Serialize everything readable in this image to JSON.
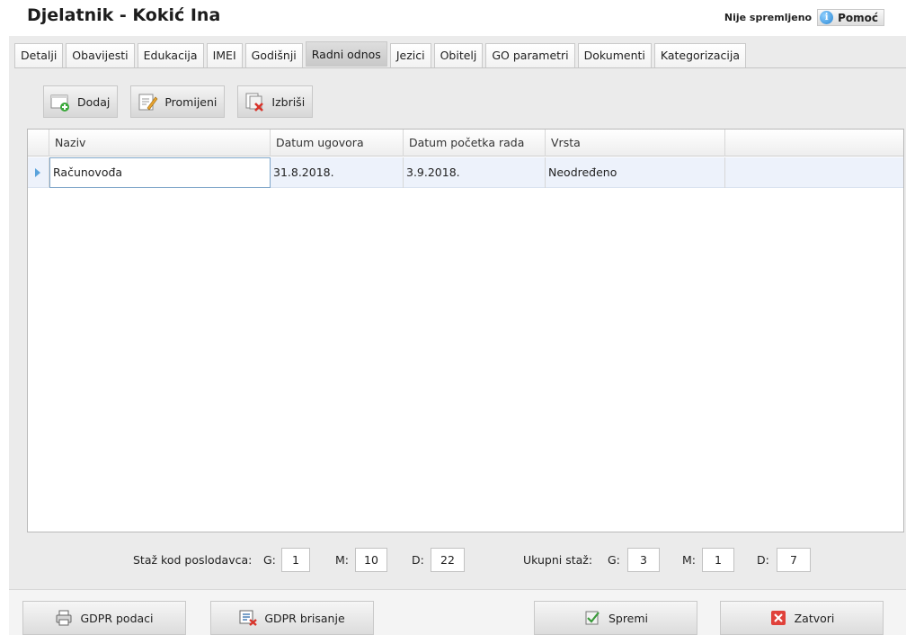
{
  "window": {
    "title": "Djelatnik - Kokić Ina",
    "status": "Nije spremljeno",
    "help_label": "Pomoć"
  },
  "tabs": [
    {
      "label": "Detalji"
    },
    {
      "label": "Obavijesti"
    },
    {
      "label": "Edukacija"
    },
    {
      "label": "IMEI"
    },
    {
      "label": "Godišnji"
    },
    {
      "label": "Radni odnos",
      "active": true
    },
    {
      "label": "Jezici"
    },
    {
      "label": "Obitelj"
    },
    {
      "label": "GO parametri"
    },
    {
      "label": "Dokumenti"
    },
    {
      "label": "Kategorizacija"
    }
  ],
  "toolbar": {
    "add_label": "Dodaj",
    "edit_label": "Promijeni",
    "delete_label": "Izbriši"
  },
  "grid": {
    "columns": [
      "Naziv",
      "Datum ugovora",
      "Datum početka rada",
      "Vrsta"
    ],
    "rows": [
      [
        "Računovođa",
        "31.8.2018.",
        "3.9.2018.",
        "Neodređeno"
      ]
    ]
  },
  "staz": {
    "employer_label": "Staž kod poslodavca:",
    "total_label": "Ukupni staž:",
    "g_label": "G:",
    "m_label": "M:",
    "d_label": "D:",
    "employer": {
      "g": "1",
      "m": "10",
      "d": "22"
    },
    "total": {
      "g": "3",
      "m": "1",
      "d": "7"
    }
  },
  "footer": {
    "gdpr_data_label": "GDPR podaci",
    "gdpr_delete_label": "GDPR brisanje",
    "save_label": "Spremi",
    "close_label": "Zatvori"
  },
  "icons": {
    "help": "info-icon",
    "add": "add-document-icon",
    "edit": "edit-document-icon",
    "delete": "delete-document-icon",
    "print": "printer-icon",
    "gdpr_delete": "list-delete-icon",
    "save": "save-icon",
    "close": "close-icon"
  },
  "colors": {
    "selected_row": "#edf2fb",
    "row_marker": "#5aa3dc",
    "close_red": "#e0413a"
  }
}
